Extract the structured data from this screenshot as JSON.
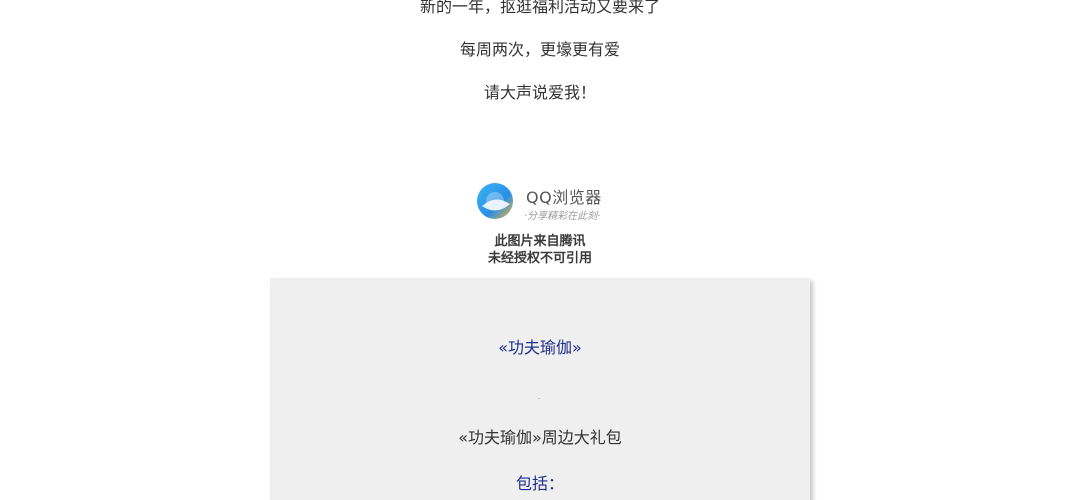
{
  "article": {
    "line1": "新的一年，抠逛福利活动又要来了",
    "line2": "每周两次，更壕更有爱",
    "line3": "请大声说爱我！"
  },
  "watermark": {
    "brand": "QQ浏览器",
    "slogan": "·分享精彩在此刻·",
    "note_line1": "此图片来自腾讯",
    "note_line2": "未经授权不可引用",
    "logo_icon": "qq-browser-logo-icon"
  },
  "promo": {
    "title": "«功夫瑜伽»",
    "subtitle": "«功夫瑜伽»周边大礼包",
    "includes_label": "包括："
  },
  "colors": {
    "body_text": "#333333",
    "link_blue": "#1f2f8f",
    "panel_bg": "#efefef"
  }
}
